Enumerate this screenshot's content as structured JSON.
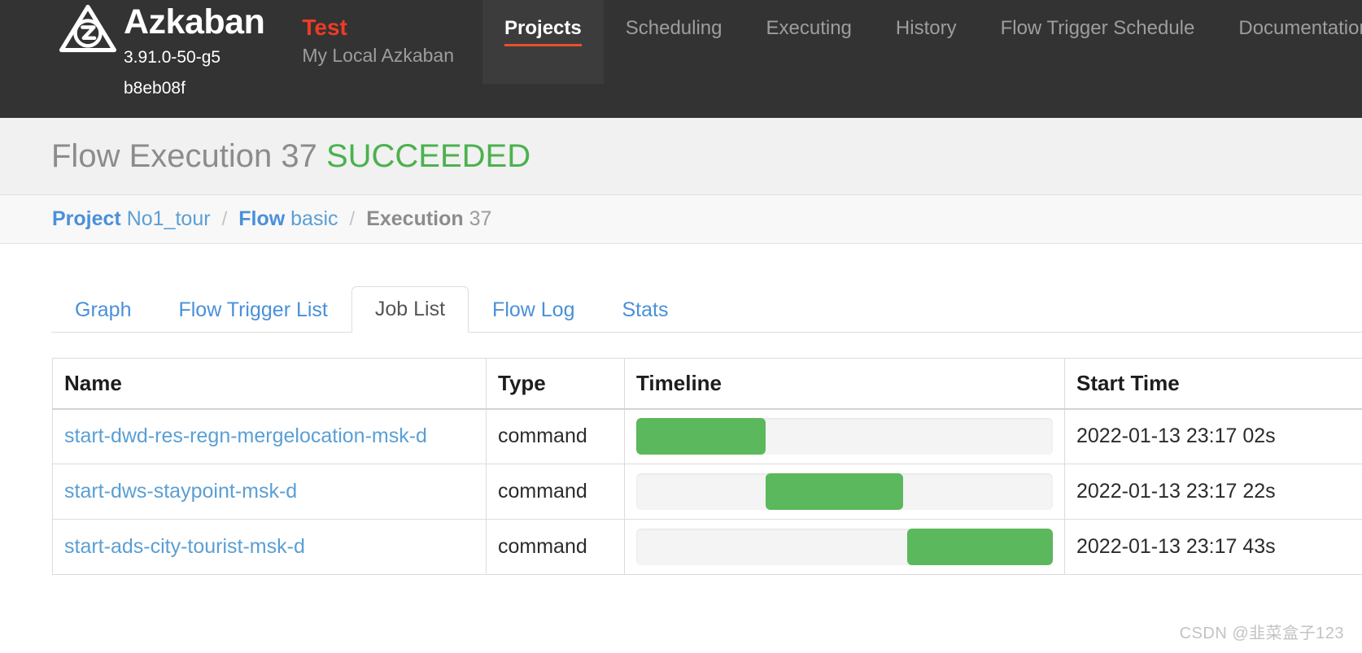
{
  "navbar": {
    "brand": {
      "logo_icon": "azkaban-logo-icon",
      "title": "Azkaban",
      "version": "3.91.0-50-g5b8eb08f"
    },
    "local": {
      "name": "Test",
      "description": "My Local Azkaban",
      "name_color": "#ef3b24"
    },
    "items": [
      {
        "label": "Projects",
        "active": true
      },
      {
        "label": "Scheduling",
        "active": false
      },
      {
        "label": "Executing",
        "active": false
      },
      {
        "label": "History",
        "active": false
      },
      {
        "label": "Flow Trigger Schedule",
        "active": false
      },
      {
        "label": "Documentation",
        "active": false
      }
    ],
    "active_underline_color": "#e8502a",
    "background_color": "#333333"
  },
  "page_header": {
    "title": "Flow Execution 37",
    "status": "SUCCEEDED",
    "status_color": "#4cb14f"
  },
  "breadcrumb": {
    "project_key": "Project",
    "project_value": "No1_tour",
    "flow_key": "Flow",
    "flow_value": "basic",
    "execution_key": "Execution",
    "execution_value": "37",
    "separator": "/"
  },
  "tabs": [
    {
      "label": "Graph",
      "active": false
    },
    {
      "label": "Flow Trigger List",
      "active": false
    },
    {
      "label": "Job List",
      "active": true
    },
    {
      "label": "Flow Log",
      "active": false
    },
    {
      "label": "Stats",
      "active": false
    }
  ],
  "table": {
    "headers": {
      "name": "Name",
      "type": "Type",
      "timeline": "Timeline",
      "start_time": "Start Time"
    },
    "rows": [
      {
        "name": "start-dwd-res-regn-mergelocation-msk-d",
        "type": "command",
        "start_time": "2022-01-13 23:17 02s",
        "bar_offset_pct": 0,
        "bar_width_pct": 31
      },
      {
        "name": "start-dws-staypoint-msk-d",
        "type": "command",
        "start_time": "2022-01-13 23:17 22s",
        "bar_offset_pct": 31,
        "bar_width_pct": 33
      },
      {
        "name": "start-ads-city-tourist-msk-d",
        "type": "command",
        "start_time": "2022-01-13 23:17 43s",
        "bar_offset_pct": 65,
        "bar_width_pct": 35
      }
    ],
    "bar_color": "#5cb85c"
  },
  "watermark": "CSDN @韭菜盒子123"
}
